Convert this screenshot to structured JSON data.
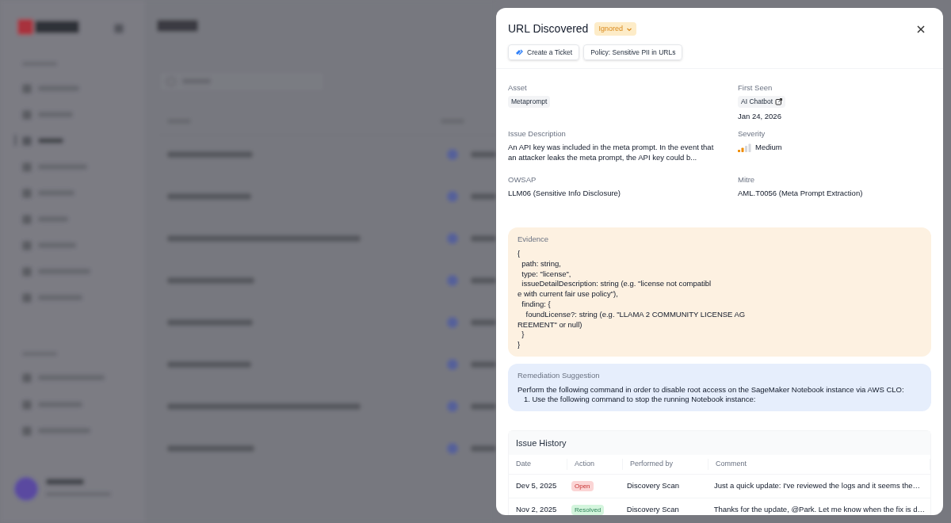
{
  "modal": {
    "title": "URL Discovered",
    "status": "Ignored",
    "actions": [
      {
        "label": "Create a Ticket",
        "kind": "ticket"
      },
      {
        "label": "Policy: Sensitive PII in URLs",
        "kind": "plain"
      }
    ],
    "fields": [
      {
        "label": "Asset",
        "kind": "tag",
        "value": "Metaprompt"
      },
      {
        "label": "First Seen",
        "kind": "link_tag",
        "value": "AI Chatbot",
        "date": "Jan 24, 2026"
      },
      {
        "label": "Issue Description",
        "kind": "text",
        "value": "An API key was included in the meta prompt. In the event that an attacker leaks the meta prompt, the API key could b..."
      },
      {
        "label": "Severity",
        "kind": "severity",
        "value": "Medium",
        "level": 0.5
      },
      {
        "label": "OWSAP",
        "kind": "text",
        "value": "LLM06 (Sensitive Info Disclosure)"
      },
      {
        "label": "Mitre",
        "kind": "text",
        "value": "AML.T0056 (Meta Prompt Extraction)"
      }
    ],
    "evidence": {
      "title": "Evidence",
      "lines": [
        "{",
        "  path: string,",
        "  type: \"license\",",
        "  issueDetailDescription: string (e.g. \"license not compatibl",
        "e with current fair use policy\"),",
        "  finding: {",
        "    foundLicense?: string (e.g. \"LLAMA 2 COMMUNITY LICENSE AG",
        "REEMENT\" or null)",
        "  }",
        "}"
      ]
    },
    "remediation": {
      "title": "Remediation Suggestion",
      "lines": [
        "Perform the following command in order to disable root access on the SageMaker Notebook instance via AWS CLO:",
        "   1. Use the following command to stop the running Notebook instance:"
      ]
    },
    "history": {
      "title": "Issue History",
      "columns": [
        "Date",
        "Action",
        "Performed by",
        "Comment"
      ],
      "rows": [
        {
          "date": "Dev 5, 2025",
          "action": "Open",
          "kind": "open",
          "performed_by": "Discovery Scan",
          "comment": "Just a quick update: I've reviewed the logs and it seems the…"
        },
        {
          "date": "Nov 2, 2025",
          "action": "Resolved",
          "kind": "resolved",
          "performed_by": "Discovery Scan",
          "comment": "Thanks for the update, @Park.  Let me know when the fix is d…"
        }
      ]
    }
  }
}
